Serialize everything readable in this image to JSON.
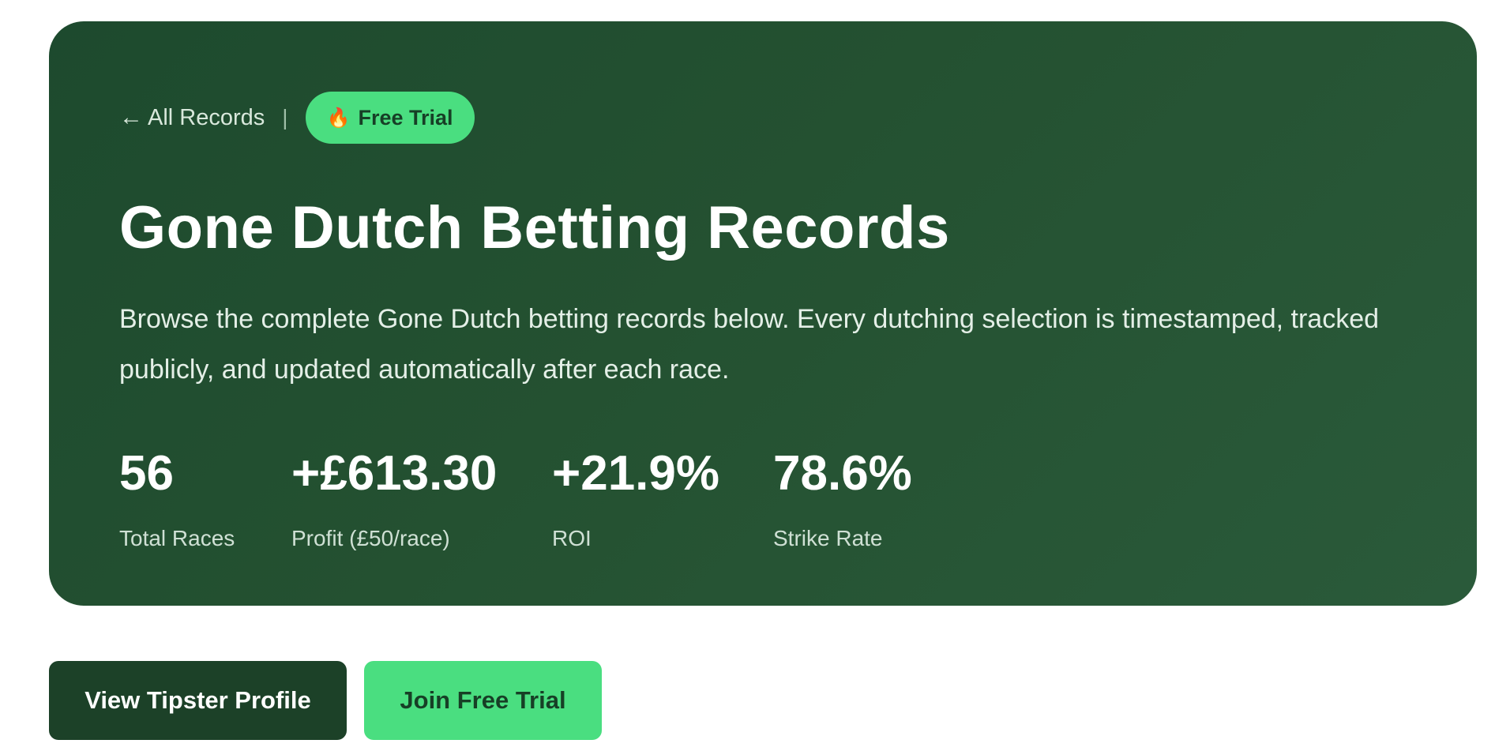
{
  "hero": {
    "back_link": "All Records",
    "back_arrow": "←",
    "divider": "|",
    "badge": {
      "icon": "fire-icon",
      "icon_glyph": "🔥",
      "label": "Free Trial"
    },
    "title": "Gone Dutch Betting Records",
    "description": "Browse the complete Gone Dutch betting records below. Every dutching selection is timestamped, tracked publicly, and updated automatically after each race.",
    "stats": [
      {
        "value": "56",
        "label": "Total Races"
      },
      {
        "value": "+£613.30",
        "label": "Profit (£50/race)"
      },
      {
        "value": "+21.9%",
        "label": "ROI"
      },
      {
        "value": "78.6%",
        "label": "Strike Rate"
      }
    ]
  },
  "actions": {
    "view_profile_label": "View Tipster Profile",
    "join_trial_label": "Join Free Trial"
  },
  "colors": {
    "hero_bg": "#1d4a2e",
    "accent_green": "#4ade80",
    "dark_button": "#1c4128"
  }
}
